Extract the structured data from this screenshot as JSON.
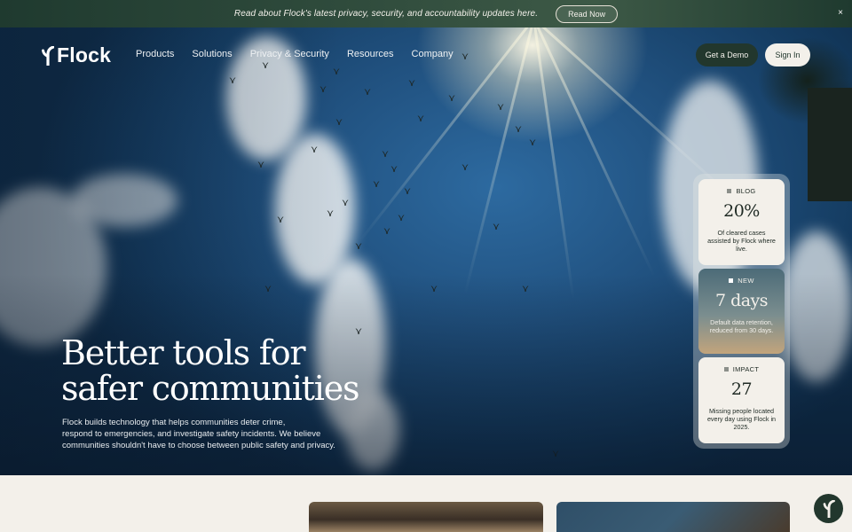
{
  "announcement": {
    "text": "Read about Flock's latest privacy, security, and accountability updates here.",
    "button_label": "Read Now",
    "close_symbol": "×"
  },
  "nav": {
    "logo_text": "Flock",
    "logo_icon": "flock-mark-icon",
    "items": [
      {
        "label": "Products"
      },
      {
        "label": "Solutions"
      },
      {
        "label": "Privacy & Security"
      },
      {
        "label": "Resources"
      },
      {
        "label": "Company"
      }
    ],
    "demo_label": "Get a Demo",
    "signin_label": "Sign In"
  },
  "hero": {
    "headline_line1": "Better tools for",
    "headline_line2": "safer communities",
    "subcopy_line1": "Flock builds technology that helps communities deter crime,",
    "subcopy_line2": "respond to emergencies, and investigate safety incidents. We believe",
    "subcopy_line3": "communities shouldn't have to choose between public safety and privacy."
  },
  "stats": [
    {
      "tag": "BLOG",
      "value": "20%",
      "description": "Of cleared cases assisted by Flock where live."
    },
    {
      "tag": "NEW",
      "value": "7 days",
      "description": "Default data retention, reduced from 30 days."
    },
    {
      "tag": "IMPACT",
      "value": "27",
      "description": "Missing people located every day using Flock in 2025."
    }
  ],
  "colors": {
    "brand_dark_green": "#22372d",
    "cream": "#f3f0ea",
    "sky_blue": "#20507e"
  },
  "fab_icon": "flock-mark-icon"
}
